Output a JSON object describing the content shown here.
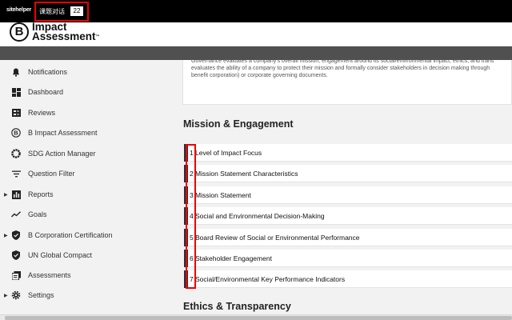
{
  "extension": {
    "logo": "sitehelper",
    "label": "课题对话",
    "count": "22"
  },
  "brand": {
    "letter": "B",
    "line1": "Impact",
    "line2": "Assessment"
  },
  "sidebar": {
    "items": [
      {
        "label": "Notifications",
        "icon": "bell-icon",
        "caret": false
      },
      {
        "label": "Dashboard",
        "icon": "dashboard-icon",
        "caret": false
      },
      {
        "label": "Reviews",
        "icon": "reviews-icon",
        "caret": false
      },
      {
        "label": "B Impact Assessment",
        "icon": "b-logo-icon",
        "caret": false
      },
      {
        "label": "SDG Action Manager",
        "icon": "sdg-icon",
        "caret": false
      },
      {
        "label": "Question Filter",
        "icon": "filter-icon",
        "caret": false
      },
      {
        "label": "Reports",
        "icon": "bar-chart-icon",
        "caret": true
      },
      {
        "label": "Goals",
        "icon": "trend-icon",
        "caret": false
      },
      {
        "label": "B Corporation Certification",
        "icon": "shield-check-icon",
        "caret": true
      },
      {
        "label": "UN Global Compact",
        "icon": "shield-check-icon",
        "caret": false
      },
      {
        "label": "Assessments",
        "icon": "stack-icon",
        "caret": false
      },
      {
        "label": "Settings",
        "icon": "gear-icon",
        "caret": true
      }
    ]
  },
  "main": {
    "description": {
      "line1": "Governance evaluates a company's overall mission, engagement around its social/environmental impact, ethics, and trans",
      "line2": "evaluates the ability of a company to protect their mission and formally consider stakeholders in decision making through",
      "line3": "benefit corporation) or corporate governing documents."
    },
    "section1_title": "Mission & Engagement",
    "questions": [
      {
        "num": "1",
        "label": "Level of Impact Focus"
      },
      {
        "num": "2",
        "label": "Mission Statement Characteristics"
      },
      {
        "num": "3",
        "label": "Mission Statement"
      },
      {
        "num": "4",
        "label": "Social and Environmental Decision-Making"
      },
      {
        "num": "5",
        "label": "Board Review of Social or Environmental Performance"
      },
      {
        "num": "6",
        "label": "Stakeholder Engagement"
      },
      {
        "num": "7",
        "label": "Social/Environmental Key Performance Indicators"
      }
    ],
    "section2_title": "Ethics & Transparency"
  },
  "colors": {
    "topbar": "#000000",
    "highlight": "#ee0000",
    "greybar": "#505050",
    "row_bar": "#2b2f36"
  }
}
